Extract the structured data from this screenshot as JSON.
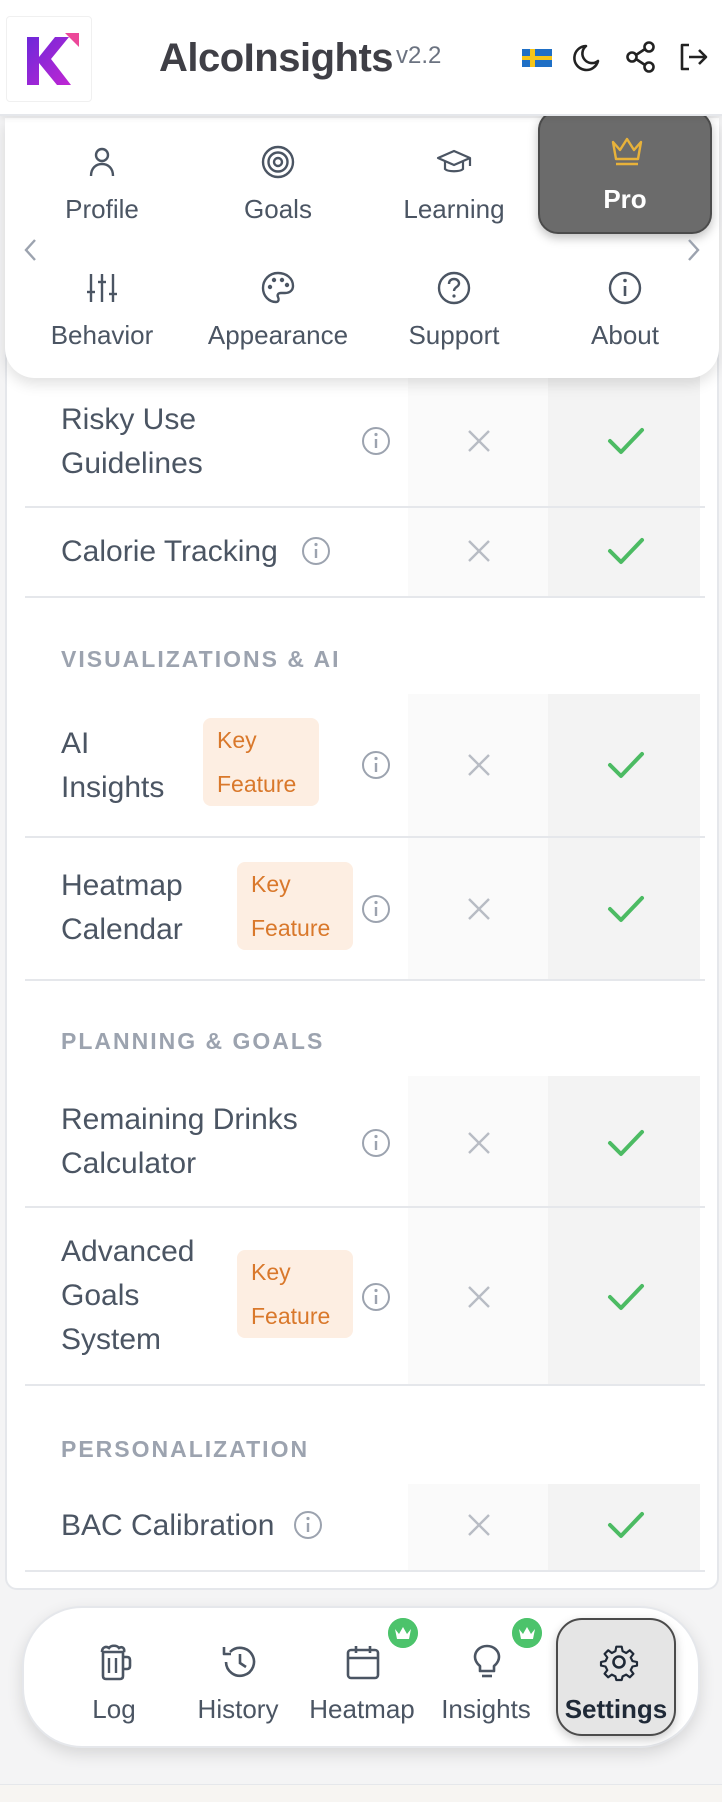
{
  "header": {
    "title": "AlcoInsights",
    "version": "v2.2",
    "flag_icon": "sweden-flag-icon",
    "theme_icon": "moon-icon",
    "share_icon": "share-icon",
    "logout_icon": "logout-icon"
  },
  "tabs": [
    {
      "label": "Profile",
      "icon": "user-icon"
    },
    {
      "label": "Goals",
      "icon": "target-icon"
    },
    {
      "label": "Learning",
      "icon": "graduation-cap-icon"
    },
    {
      "label": "Pro",
      "icon": "crown-icon",
      "active": true
    },
    {
      "label": "Behavior",
      "icon": "sliders-icon"
    },
    {
      "label": "Appearance",
      "icon": "palette-icon"
    },
    {
      "label": "Support",
      "icon": "help-circle-icon"
    },
    {
      "label": "About",
      "icon": "info-icon"
    }
  ],
  "comparison": {
    "rows": [
      {
        "name_lines": [
          "Risky Use",
          "Guidelines"
        ],
        "free": false,
        "pro": true
      },
      {
        "name_lines": [
          "Calorie Tracking"
        ],
        "free": false,
        "pro": true
      }
    ],
    "sections": [
      {
        "title": "VISUALIZATIONS & AI",
        "rows": [
          {
            "name_lines": [
              "AI",
              "Insights"
            ],
            "badge_lines": [
              "Key",
              "Feature"
            ],
            "free": false,
            "pro": true
          },
          {
            "name_lines": [
              "Heatmap",
              "Calendar"
            ],
            "badge_lines": [
              "Key",
              "Feature"
            ],
            "free": false,
            "pro": true
          }
        ]
      },
      {
        "title": "PLANNING & GOALS",
        "rows": [
          {
            "name_lines": [
              "Remaining Drinks",
              "Calculator"
            ],
            "free": false,
            "pro": true
          },
          {
            "name_lines": [
              "Advanced",
              "Goals",
              "System"
            ],
            "badge_lines": [
              "Key",
              "Feature"
            ],
            "free": false,
            "pro": true
          }
        ]
      },
      {
        "title": "PERSONALIZATION",
        "rows": [
          {
            "name_lines": [
              "BAC Calibration"
            ],
            "free": false,
            "pro": true
          }
        ]
      }
    ]
  },
  "bottom_nav": [
    {
      "label": "Log",
      "icon": "trash-log-icon"
    },
    {
      "label": "History",
      "icon": "history-icon"
    },
    {
      "label": "Heatmap",
      "icon": "calendar-icon",
      "pro_badge": true
    },
    {
      "label": "Insights",
      "icon": "lightbulb-icon",
      "pro_badge": true
    },
    {
      "label": "Settings",
      "icon": "gear-icon",
      "active": true
    }
  ],
  "colors": {
    "accent_purple": "#7c3aed",
    "pro_gold": "#e8b23a",
    "check_green": "#4cbb63",
    "badge_orange": "#d9782b"
  }
}
